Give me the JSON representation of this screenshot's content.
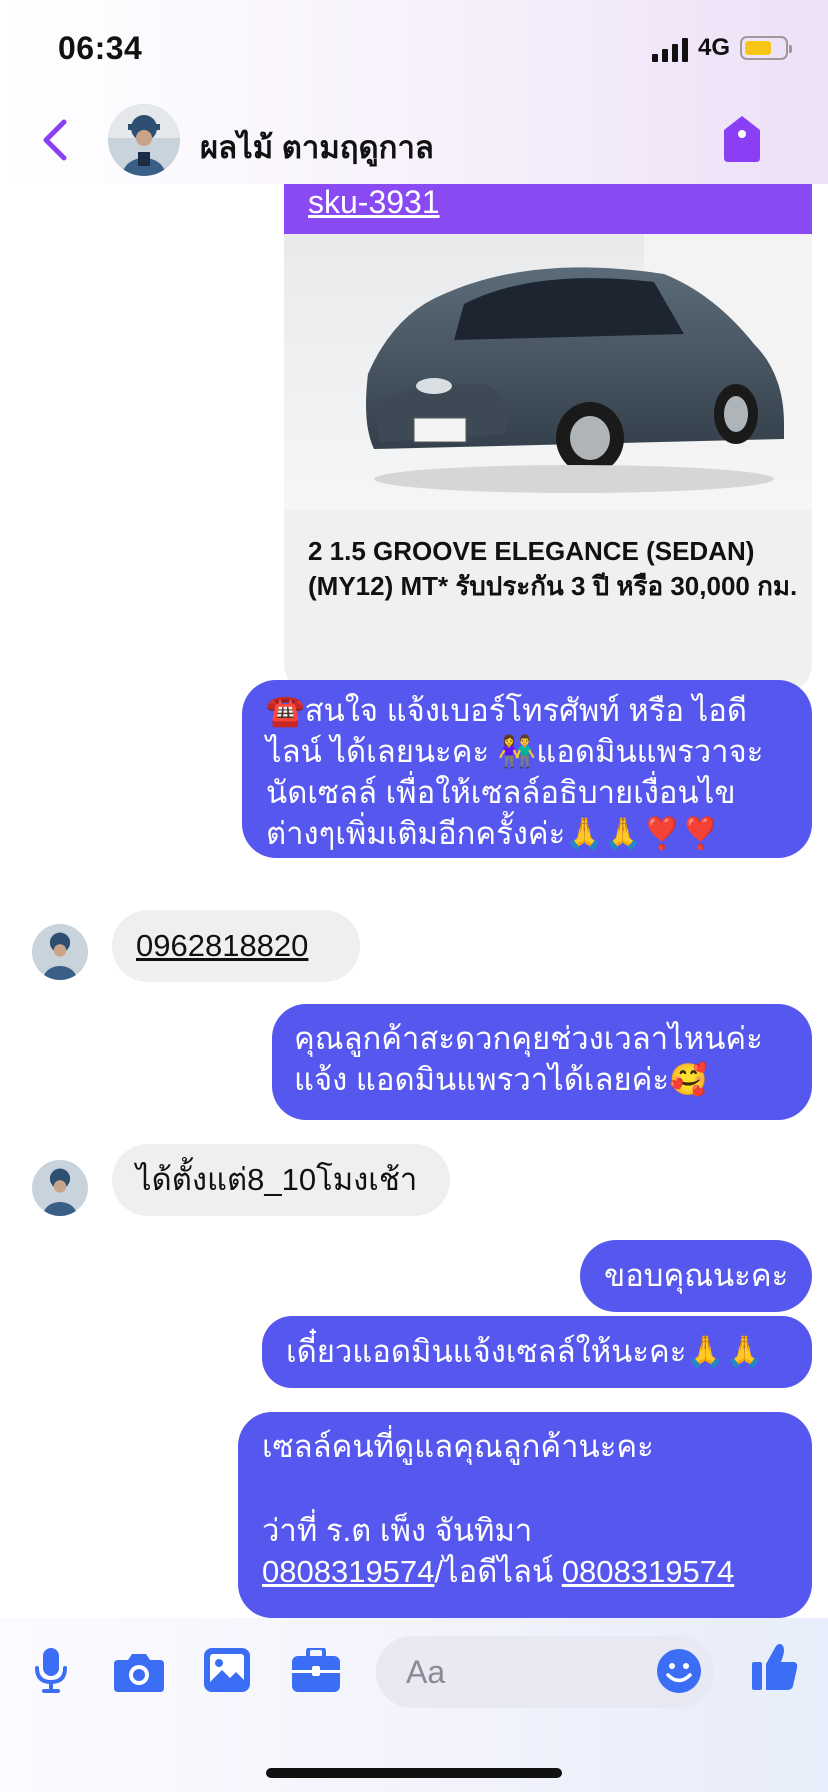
{
  "status": {
    "time": "06:34",
    "network": "4G"
  },
  "header": {
    "title": "ผลไม้ ตามฤดูกาล"
  },
  "product_card": {
    "sku": "sku-3931",
    "description": "2 1.5 GROOVE ELEGANCE (SEDAN) (MY12) MT* รับประกัน 3 ปี หรือ 30,000 กม."
  },
  "messages": [
    {
      "side": "out",
      "text": "☎️สนใจ แจ้งเบอร์โทรศัพท์ หรือ ไอดีไลน์  ได้เลยนะคะ 👫แอดมินแพรวาจะนัดเซลล์     เพื่อให้เซลล์อธิบายเงื่อนไขต่างๆเพิ่มเติมอีกครั้งค่ะ🙏🙏❣️❣️"
    },
    {
      "side": "in",
      "text": "0962818820"
    },
    {
      "side": "out",
      "text": "คุณลูกค้าสะดวกคุยช่วงเวลาไหนค่ะ แจ้ง แอดมินแพรวาได้เลยค่ะ🥰"
    },
    {
      "side": "in",
      "text": "ได้ตั้งแต่8_10โมงเช้า"
    },
    {
      "side": "out",
      "text": "ขอบคุณนะคะ"
    },
    {
      "side": "out",
      "text": "เดี๋ยวแอดมินแจ้งเซลล์ให้นะคะ🙏🙏"
    },
    {
      "side": "out",
      "line1": "เซลล์คนที่ดูแลคุณลูกค้านะคะ",
      "line2": "ว่าที่ ร.ต เพ็ง จันทิมา",
      "phone": "0808319574",
      "separator": "/ไอดีไลน์ ",
      "line_id": "0808319574"
    }
  ],
  "composer": {
    "placeholder": "Aa"
  },
  "icons": [
    "back-arrow-icon",
    "tag-icon",
    "microphone-icon",
    "camera-icon",
    "gallery-icon",
    "briefcase-icon",
    "emoji-icon",
    "thumbs-up-icon"
  ],
  "colors": {
    "outgoing": "#5557ef",
    "incoming": "#efefef",
    "sku_banner": "#8a4af3",
    "accent": "#7b3ff2",
    "icons": "#3b6ef5"
  }
}
